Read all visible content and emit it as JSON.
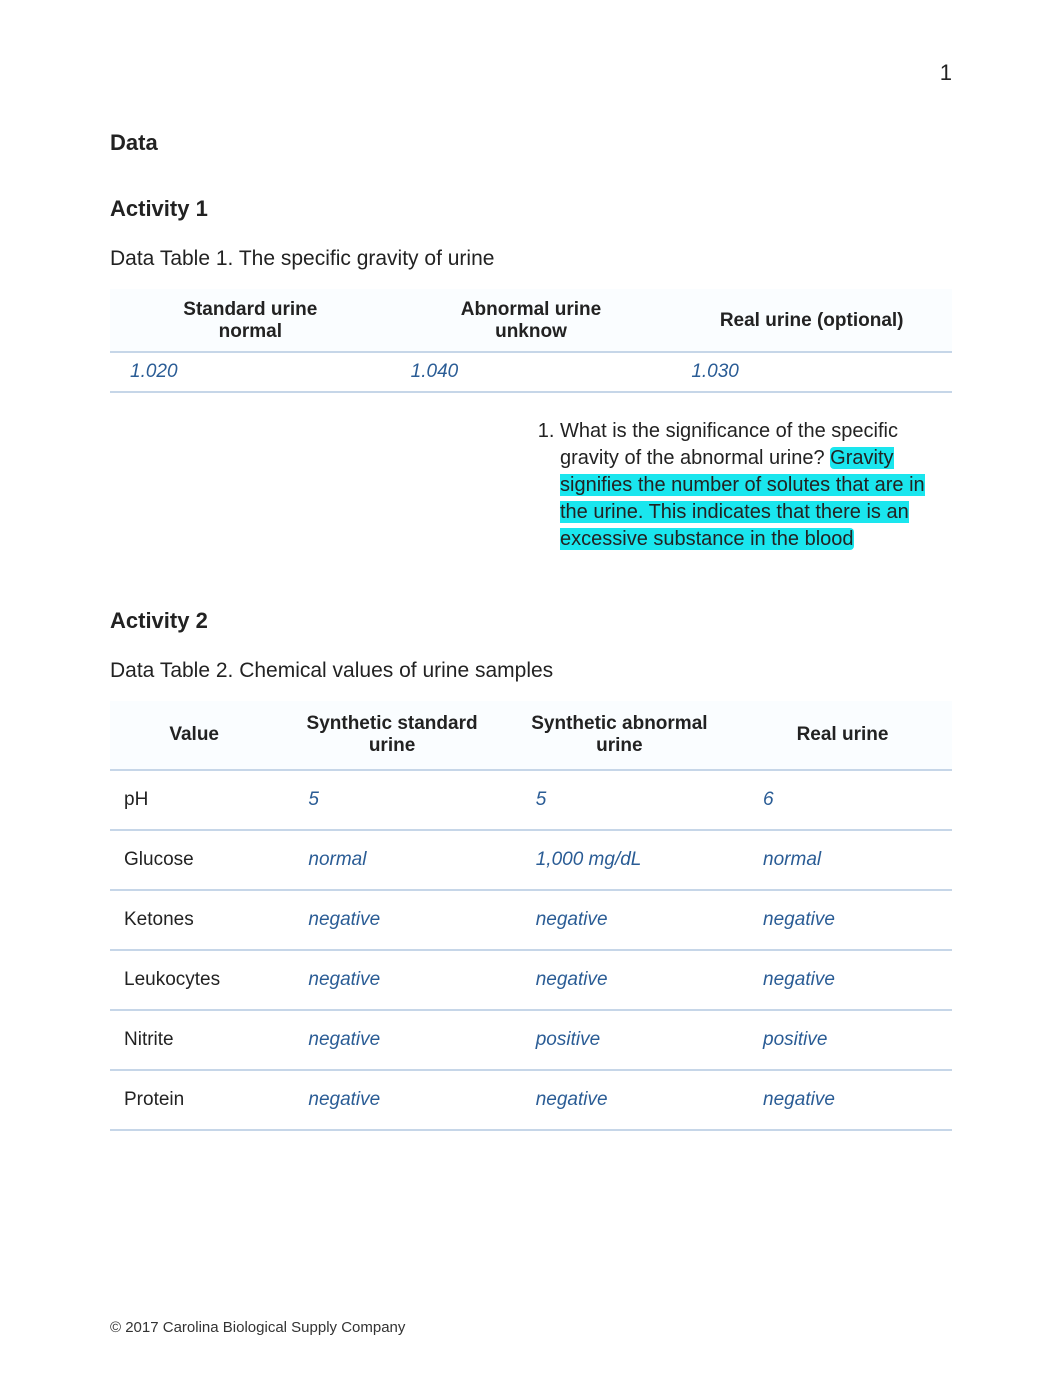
{
  "page_number": "1",
  "headings": {
    "data": "Data",
    "activity1": "Activity 1",
    "activity2": "Activity 2"
  },
  "table1": {
    "caption": "Data Table 1. The specific gravity of urine",
    "headers": {
      "h1a": "Standard urine",
      "h1b": "normal",
      "h2a": "Abnormal urine",
      "h2b": "unknow",
      "h3a": "Real urine (optional)"
    },
    "row": {
      "c1": "1.020",
      "c2": "1.040",
      "c3": "1.030"
    }
  },
  "question": {
    "lead": "What is the significance of the specific gravity of the abnormal urine? ",
    "answer": "Gravity signifies the number of solutes that are in the urine.  This indicates that there is an excessive substance in the blood"
  },
  "table2": {
    "caption": "Data Table 2. Chemical values of urine samples",
    "headers": {
      "h1": "Value",
      "h2": "Synthetic standard urine",
      "h3": "Synthetic abnormal urine",
      "h4": "Real urine"
    },
    "rows": [
      {
        "label": "pH",
        "c1": "5",
        "c2": "5",
        "c3": "6"
      },
      {
        "label": "Glucose",
        "c1": "normal",
        "c2": "1,000 mg/dL",
        "c3": "normal"
      },
      {
        "label": "Ketones",
        "c1": "negative",
        "c2": "negative",
        "c3": "negative"
      },
      {
        "label": "Leukocytes",
        "c1": "negative",
        "c2": "negative",
        "c3": "negative"
      },
      {
        "label": "Nitrite",
        "c1": "negative",
        "c2": "positive",
        "c3": "positive"
      },
      {
        "label": "Protein",
        "c1": "negative",
        "c2": "negative",
        "c3": "negative"
      }
    ]
  },
  "footer": "© 2017 Carolina Biological Supply Company",
  "chart_data": [
    {
      "type": "table",
      "title": "Data Table 1. The specific gravity of urine",
      "columns": [
        "Standard urine normal",
        "Abnormal urine unknow",
        "Real urine (optional)"
      ],
      "rows": [
        [
          1.02,
          1.04,
          1.03
        ]
      ]
    },
    {
      "type": "table",
      "title": "Data Table 2. Chemical values of urine samples",
      "columns": [
        "Value",
        "Synthetic standard urine",
        "Synthetic abnormal urine",
        "Real urine"
      ],
      "rows": [
        [
          "pH",
          "5",
          "5",
          "6"
        ],
        [
          "Glucose",
          "normal",
          "1,000 mg/dL",
          "normal"
        ],
        [
          "Ketones",
          "negative",
          "negative",
          "negative"
        ],
        [
          "Leukocytes",
          "negative",
          "negative",
          "negative"
        ],
        [
          "Nitrite",
          "negative",
          "positive",
          "positive"
        ],
        [
          "Protein",
          "negative",
          "negative",
          "negative"
        ]
      ]
    }
  ]
}
